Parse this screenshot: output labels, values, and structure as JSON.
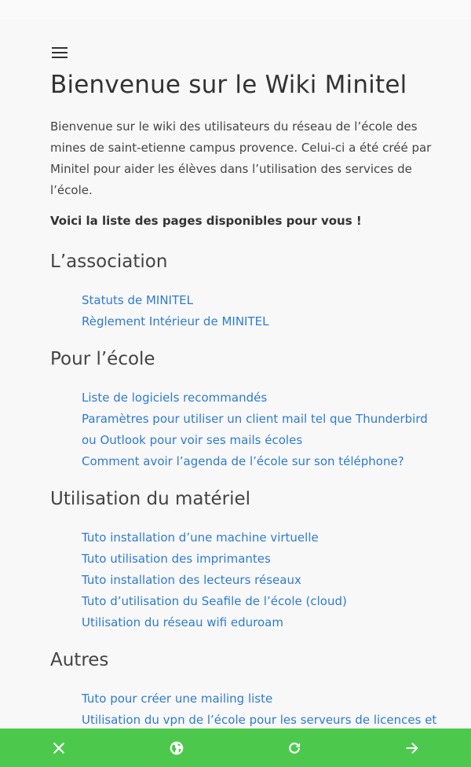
{
  "page": {
    "title": "Bienvenue sur le Wiki Minitel",
    "intro": "Bienvenue sur le wiki des utilisateurs du réseau de l’école des mines de saint-etienne campus provence. Celui-ci a été créé par Minitel pour aider les élèves dans l’utilisation des services de l’école.",
    "lead": "Voici la liste des pages disponibles pour vous !"
  },
  "sections": [
    {
      "title": "L’association",
      "links": [
        "Statuts de MINITEL",
        "Règlement Intérieur de MINITEL"
      ]
    },
    {
      "title": "Pour l’école",
      "links": [
        "Liste de logiciels recommandés",
        "Paramètres pour utiliser un client mail tel que Thunderbird ou Outlook pour voir ses mails écoles",
        "Comment avoir l’agenda de l’école sur son téléphone?"
      ]
    },
    {
      "title": "Utilisation du matériel",
      "links": [
        "Tuto installation d’une machine virtuelle",
        "Tuto utilisation des imprimantes",
        "Tuto installation des lecteurs réseaux",
        "Tuto d’utilisation du Seafile de l’école (cloud)",
        "Utilisation du réseau wifi eduroam"
      ]
    },
    {
      "title": "Autres",
      "links": [
        "Tuto pour créer une mailing liste",
        "Utilisation du vpn de l’école pour les serveurs de licences et"
      ]
    }
  ],
  "bottom_bar": {
    "color": "#4cc94d",
    "icons": [
      "close-icon",
      "globe-icon",
      "refresh-icon",
      "arrow-forward-icon"
    ]
  }
}
